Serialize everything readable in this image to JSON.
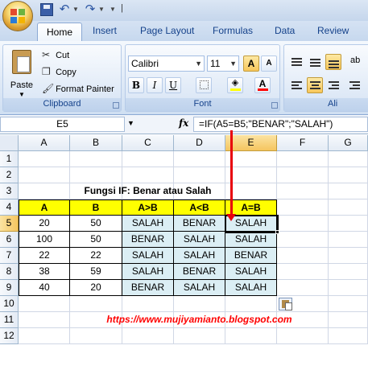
{
  "quick_access": {
    "separator": "|"
  },
  "tabs": [
    "Home",
    "Insert",
    "Page Layout",
    "Formulas",
    "Data",
    "Review"
  ],
  "clipboard": {
    "paste_label": "Paste",
    "cut_label": "Cut",
    "copy_label": "Copy",
    "format_painter_label": "Format Painter",
    "group_label": "Clipboard"
  },
  "font": {
    "family": "Calibri",
    "size": "11",
    "group_label": "Font",
    "bold": "B",
    "italic": "I",
    "underline": "U",
    "grow": "A",
    "shrink": "A",
    "font_color_letter": "A"
  },
  "alignment": {
    "group_label": "Ali"
  },
  "formula_bar": {
    "name_box": "E5",
    "fx": "fx",
    "formula": "=IF(A5=B5;\"BENAR\";\"SALAH\")"
  },
  "grid": {
    "columns": [
      "A",
      "B",
      "C",
      "D",
      "E",
      "F",
      "G"
    ],
    "rows": [
      "1",
      "2",
      "3",
      "4",
      "5",
      "6",
      "7",
      "8",
      "9",
      "10",
      "11",
      "12"
    ],
    "selected_cell": "E5",
    "title": "Fungsi IF: Benar atau Salah",
    "table_headers": [
      "A",
      "B",
      "A>B",
      "A<B",
      "A=B"
    ],
    "table_rows": [
      [
        "20",
        "50",
        "SALAH",
        "BENAR",
        "SALAH"
      ],
      [
        "100",
        "50",
        "BENAR",
        "SALAH",
        "SALAH"
      ],
      [
        "22",
        "22",
        "SALAH",
        "SALAH",
        "BENAR"
      ],
      [
        "38",
        "59",
        "SALAH",
        "BENAR",
        "SALAH"
      ],
      [
        "40",
        "20",
        "BENAR",
        "SALAH",
        "SALAH"
      ]
    ],
    "url": "https://www.mujiyamianto.blogspot.com"
  },
  "colors": {
    "header_fill": "#ffff00",
    "result_fill": "#dbeef4",
    "url_color": "#ff0000",
    "arrow_color": "#e8000b",
    "ribbon_accent": "#15428b"
  }
}
